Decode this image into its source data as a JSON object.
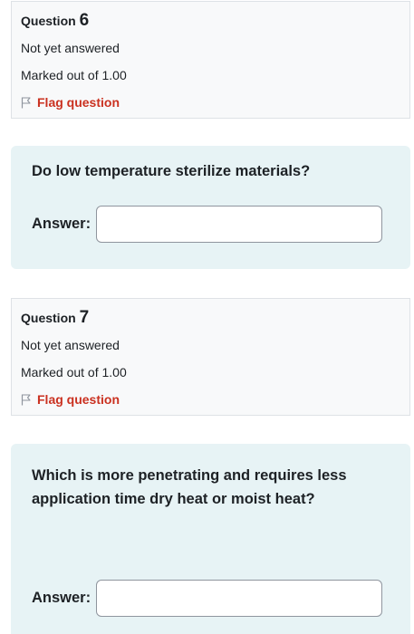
{
  "questions": [
    {
      "title_prefix": "Question",
      "number": "6",
      "status": "Not yet answered",
      "marks": "Marked out of 1.00",
      "flag_label": "Flag question",
      "question_text": "Do low temperature sterilize materials?",
      "answer_label": "Answer:",
      "answer_value": ""
    },
    {
      "title_prefix": "Question",
      "number": "7",
      "status": "Not yet answered",
      "marks": "Marked out of 1.00",
      "flag_label": "Flag question",
      "question_text": "Which is more penetrating and requires less application time dry heat or moist heat?",
      "answer_label": "Answer:",
      "answer_value": ""
    }
  ],
  "colors": {
    "flag": "#ca3120",
    "info_bg": "#f8f9fa",
    "content_bg": "#e7f3f5"
  },
  "icons": {
    "flag": "flag-outline-icon"
  }
}
